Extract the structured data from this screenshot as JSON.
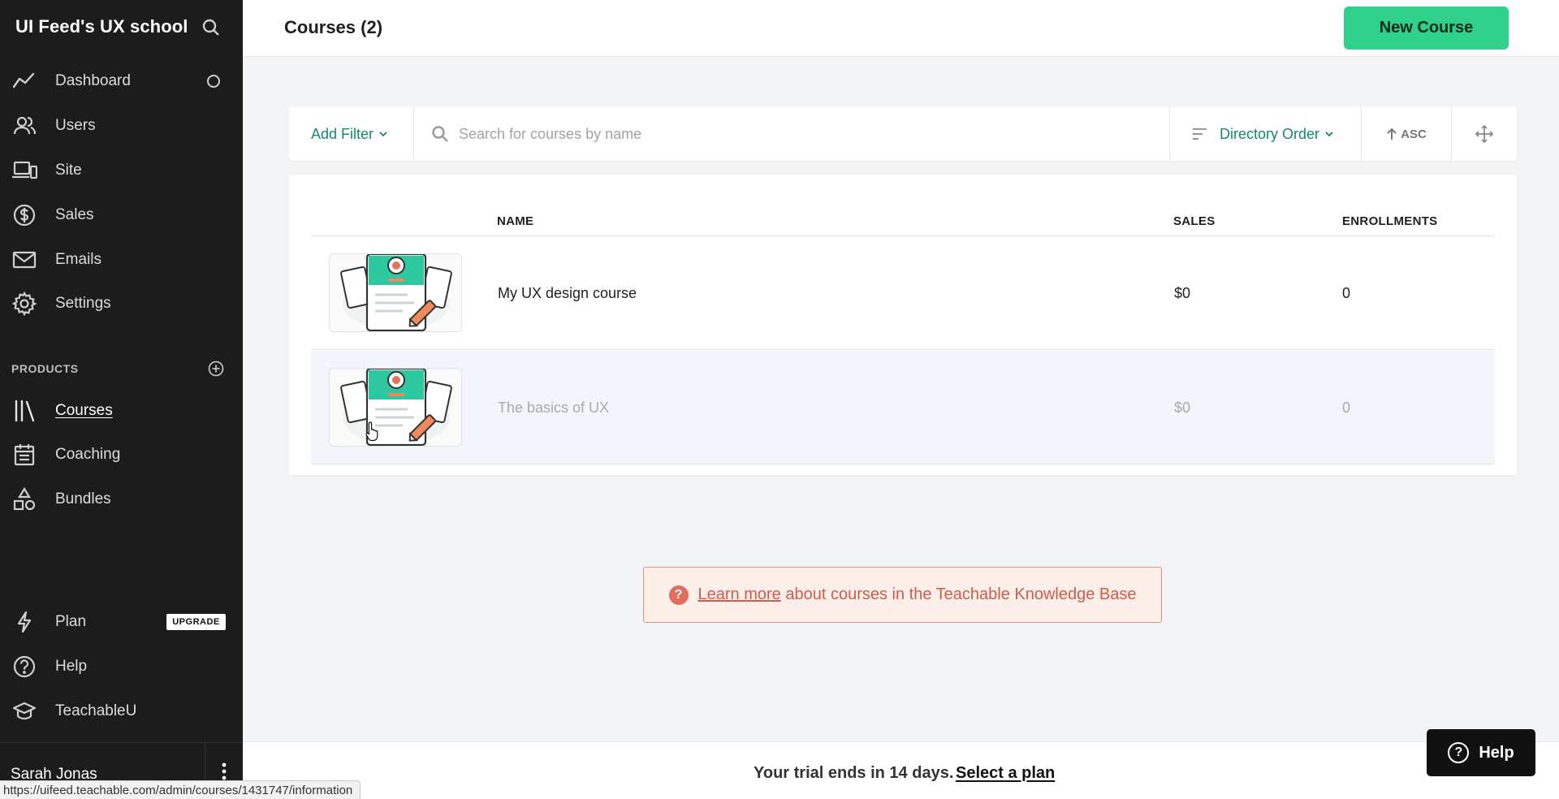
{
  "sidebar": {
    "brand": "UI Feed's UX school",
    "nav": [
      {
        "label": "Dashboard",
        "icon": "trend-line-icon"
      },
      {
        "label": "Users",
        "icon": "users-icon"
      },
      {
        "label": "Site",
        "icon": "devices-icon"
      },
      {
        "label": "Sales",
        "icon": "dollar-circle-icon"
      },
      {
        "label": "Emails",
        "icon": "envelope-icon"
      },
      {
        "label": "Settings",
        "icon": "gear-icon"
      }
    ],
    "products_label": "PRODUCTS",
    "products": [
      {
        "label": "Courses",
        "icon": "library-icon",
        "active": true
      },
      {
        "label": "Coaching",
        "icon": "calendar-icon"
      },
      {
        "label": "Bundles",
        "icon": "shapes-icon"
      }
    ],
    "bottom": [
      {
        "label": "Plan",
        "icon": "lightning-icon"
      },
      {
        "label": "Help",
        "icon": "help-circle-icon"
      },
      {
        "label": "TeachableU",
        "icon": "graduation-cap-icon"
      }
    ],
    "upgrade_label": "UPGRADE",
    "user_name": "Sarah Jonas"
  },
  "header": {
    "title": "Courses (2)",
    "new_button": "New Course"
  },
  "filters": {
    "add_filter": "Add Filter",
    "search_placeholder": "Search for courses by name",
    "search_value": "",
    "order": "Directory Order",
    "direction": "ASC"
  },
  "table": {
    "columns": [
      "NAME",
      "SALES",
      "ENROLLMENTS"
    ],
    "rows": [
      {
        "name": "My UX design course",
        "sales": "$0",
        "enrollments": "0"
      },
      {
        "name": "The basics of UX",
        "sales": "$0",
        "enrollments": "0"
      }
    ]
  },
  "banner": {
    "link": "Learn more",
    "text": " about courses in the Teachable Knowledge Base"
  },
  "trial": {
    "text": "Your trial ends in 14 days.",
    "link": "Select a plan"
  },
  "help_button": "Help",
  "status_url": "https://uifeed.teachable.com/admin/courses/1431747/information",
  "colors": {
    "sidebar_bg": "#1c1c1c",
    "accent_green": "#2fd089",
    "link_green": "#138a6a",
    "banner_red": "#cf5b4b"
  }
}
